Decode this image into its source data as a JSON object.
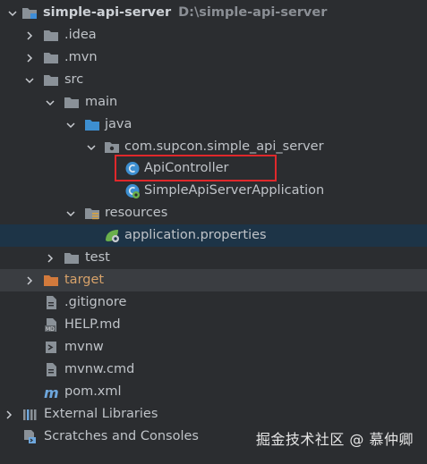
{
  "tree": {
    "root": {
      "label": "simple-api-server",
      "path": "D:\\simple-api-server"
    },
    "idea": ".idea",
    "mvn": ".mvn",
    "src": "src",
    "main": "main",
    "java": "java",
    "package": "com.supcon.simple_api_server",
    "api_controller": "ApiController",
    "application_class": "SimpleApiServerApplication",
    "resources": "resources",
    "application_properties": "application.properties",
    "test": "test",
    "target": "target",
    "gitignore": ".gitignore",
    "help_md": "HELP.md",
    "mvnw": "mvnw",
    "mvnw_cmd": "mvnw.cmd",
    "pom": "pom.xml",
    "external_libraries": "External Libraries",
    "scratches": "Scratches and Consoles"
  },
  "icons": {
    "folder": "folder-icon",
    "blue_folder": "source-folder-icon",
    "package": "package-icon",
    "java_class": "java-class-icon",
    "spring_app": "spring-boot-class-icon",
    "resources_folder": "resources-folder-icon",
    "properties": "spring-properties-icon",
    "target_folder": "excluded-folder-icon",
    "text_file": "text-file-icon",
    "markdown_file": "markdown-file-icon",
    "shell_file": "shell-file-icon",
    "maven_file": "maven-icon",
    "libraries": "libraries-icon",
    "scratches": "scratches-icon"
  },
  "colors": {
    "background": "#2b2d30",
    "selection": "#1d3447",
    "excluded_row": "#3a3d41",
    "highlight_box": "#e0282b",
    "target_label": "#d7a26a"
  },
  "watermark": "掘金技术社区 @ 慕仲卿"
}
